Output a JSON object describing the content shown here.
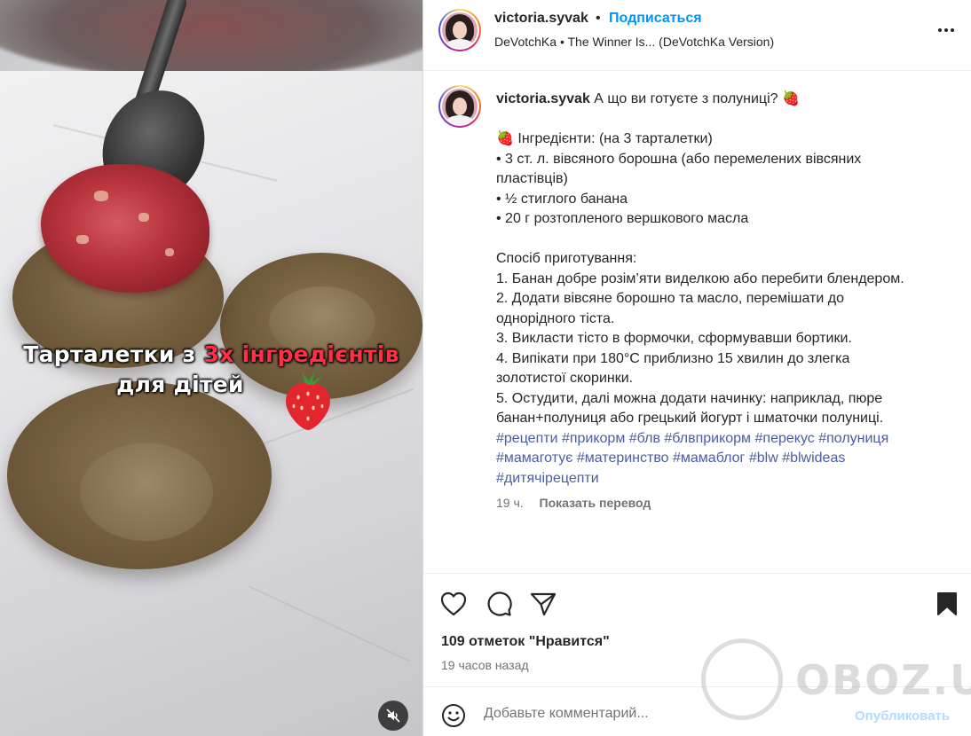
{
  "media": {
    "overlay_line1_a": "Тарталетки з ",
    "overlay_line1_b": "3х інгредієнтів",
    "overlay_line2": "для дітей",
    "mute_icon": "volume-muted-icon"
  },
  "header": {
    "username": "victoria.syvak",
    "separator": "•",
    "follow_label": "Подписаться",
    "audio": "DeVotchKa • The Winner Is... (DeVotchKa Version)",
    "more_icon": "more-horizontal-icon"
  },
  "caption": {
    "username": "victoria.syvak",
    "intro": " А що ви готуєте з полуниці? 🍓",
    "ingredients_title": "🍓 Інгредієнти: (на 3 тарталетки)",
    "ingredients": [
      "• 3 ст. л. вівсяного борошна (або перемелених вівсяних",
      "пластівців)",
      "• ½ стиглого банана",
      "• 20 г розтопленого вершкового масла"
    ],
    "method_title": "Спосіб приготування:",
    "steps": [
      "1. Банан добре розім’яти виделкою або перебити блендером.",
      "2. Додати вівсяне борошно та масло, перемішати до",
      "однорідного тіста.",
      "3. Викласти тісто в формочки, сформувавши бортики.",
      "4. Випікати при 180°C приблизно 15 хвилин до злегка",
      "золотистої скоринки.",
      "5. Остудити, далі можна додати начинку: наприклад, пюре",
      "банан+полуниця або грецький йогурт і шматочки полуниці."
    ],
    "hashtags_line1": "#рецепти #прикорм #блв #блвприкорм #перекус #полуниця",
    "hashtags_line2": "#мамаготує #материнство #мамаблог #blw #blwideas",
    "hashtags_line3": "#дитячірецепти",
    "time": "19 ч.",
    "translate_label": "Показать перевод"
  },
  "actions": {
    "like_icon": "heart-icon",
    "comment_icon": "comment-icon",
    "share_icon": "send-icon",
    "save_icon": "bookmark-icon",
    "likes_text": "109 отметок \"Нравится\"",
    "posted_ago": "19 часов назад"
  },
  "comment": {
    "emoji_icon": "emoji-icon",
    "placeholder": "Добавьте комментарий...",
    "publish_label": "Опубликовать"
  },
  "watermark": {
    "text": "OBOZ.UA"
  },
  "colors": {
    "accent_blue": "#0095f6",
    "hashtag": "#4a5da4",
    "publish_disabled": "#b3dbff",
    "overlay_highlight": "#ff2f45"
  }
}
